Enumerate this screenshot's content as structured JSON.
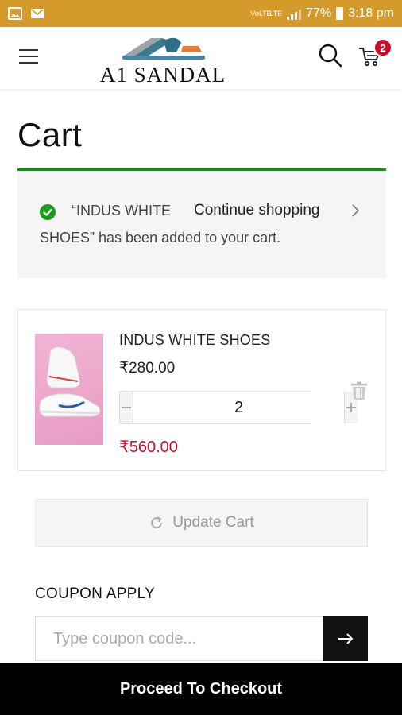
{
  "status_bar": {
    "network_label": "VoLTE",
    "network_type": "LTE",
    "battery": "77%",
    "time": "3:18 pm",
    "icons": [
      "image-icon",
      "mail-icon",
      "signal-icon",
      "battery-icon"
    ]
  },
  "header": {
    "logo_text": "A1 SANDAL",
    "cart_count": "2",
    "colors": {
      "badge": "#c8102e"
    }
  },
  "page": {
    "title": "Cart",
    "accent_color": "#1e8a1e"
  },
  "notice": {
    "line1": "“INDUS WHITE",
    "line2": "SHOES” has been added to your cart.",
    "continue_label": "Continue shopping"
  },
  "cart_item": {
    "name": "INDUS WHITE SHOES",
    "price": "₹280.00",
    "quantity": "2",
    "line_total": "₹560.00"
  },
  "actions": {
    "update_cart_label": "Update Cart"
  },
  "coupon": {
    "title": "COUPON APPLY",
    "placeholder": "Type coupon code..."
  },
  "checkout": {
    "label": "Proceed To Checkout"
  }
}
